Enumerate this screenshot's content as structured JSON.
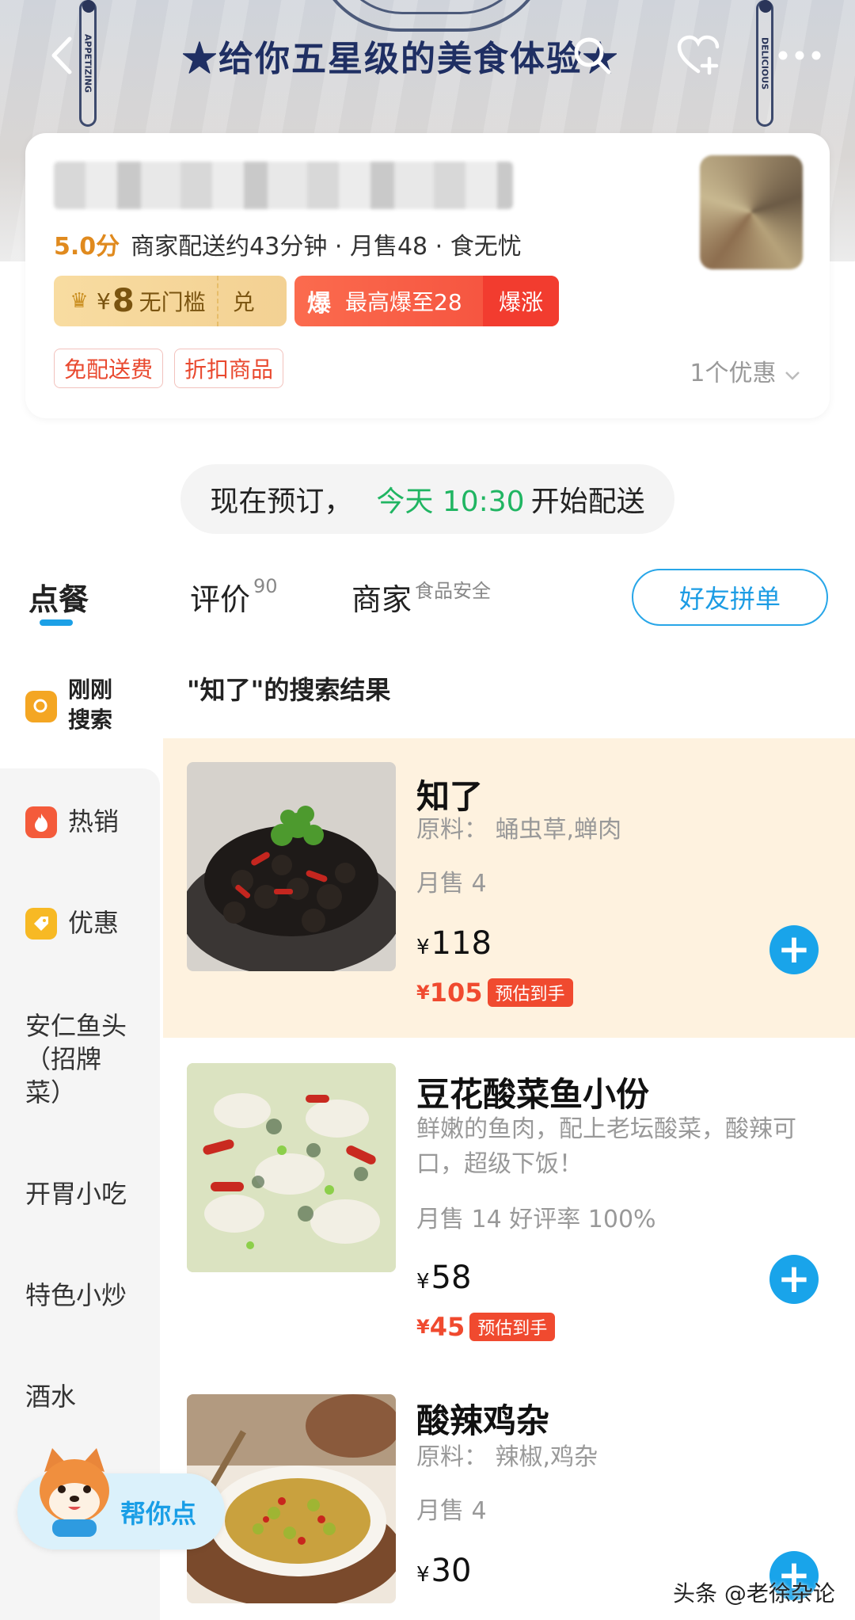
{
  "banner": {
    "title": "★给你五星级的美食体验★",
    "badge_left": "APPETIZING",
    "badge_right": "DELICIOUS"
  },
  "store": {
    "score": "5.0分",
    "delivery": "商家配送约43分钟 · 月售48 · 食无忧",
    "coupon_gold": {
      "currency": "¥",
      "amount": "8",
      "label": "无门槛",
      "action": "兑"
    },
    "coupon_red": {
      "badge": "爆",
      "label": "最高爆至28",
      "action": "爆涨"
    },
    "tags": [
      "免配送费",
      "折扣商品"
    ],
    "promo_count": "1个优惠"
  },
  "preorder": {
    "prefix": "现在预订，",
    "highlight": "今天 10:30",
    "suffix": "开始配送"
  },
  "tabs": {
    "order": "点餐",
    "review": "评价",
    "review_count": "90",
    "merchant": "商家",
    "merchant_sub": "食品安全",
    "friend_button": "好友拼单"
  },
  "categories": {
    "recent": "刚刚\n搜索",
    "hot": "热销",
    "promo": "优惠",
    "signature": "安仁鱼头\n（招牌\n菜）",
    "snacks": "开胃小吃",
    "stirfry": "特色小炒",
    "drinks": "酒水"
  },
  "results_title": "\"知了\"的搜索结果",
  "items": [
    {
      "name": "知了",
      "desc": "原料：  蛹虫草,蝉肉",
      "sales": "月售 4",
      "currency": "¥",
      "price": "118",
      "deal_price": "105",
      "deal_label": "预估到手"
    },
    {
      "name": "豆花酸菜鱼小份",
      "desc": "鲜嫩的鱼肉，配上老坛酸菜，酸辣可口，超级下饭！",
      "sales": "月售 14   好评率 100%",
      "currency": "¥",
      "price": "58",
      "deal_price": "45",
      "deal_label": "预估到手"
    },
    {
      "name": "酸辣鸡杂",
      "desc": "原料：  辣椒,鸡杂",
      "sales": "月售 4",
      "currency": "¥",
      "price": "30"
    }
  ],
  "helper": {
    "label": "帮你点"
  },
  "watermark": "头条 @老徐杂论"
}
